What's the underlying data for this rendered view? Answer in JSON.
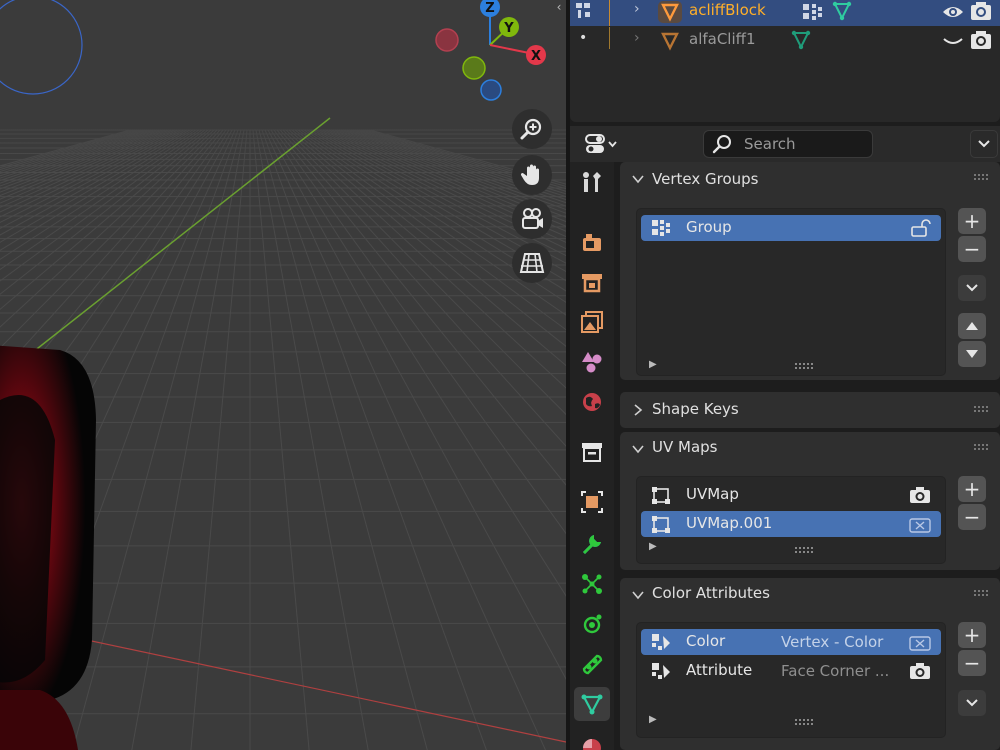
{
  "outliner": {
    "rows": [
      {
        "name": "acliffBlock",
        "selected": true
      },
      {
        "name": "alfaCliff1",
        "selected": false
      }
    ]
  },
  "properties": {
    "search_placeholder": "Search",
    "tabs": [
      "tool-icon",
      "render-icon",
      "output-icon",
      "view-layer-icon",
      "scene-icon",
      "world-icon",
      "collection-icon",
      "object-icon",
      "modifier-icon",
      "particles-icon",
      "physics-icon",
      "constraints-icon",
      "object-data-icon",
      "material-icon"
    ],
    "active_tab": "object-data-icon",
    "panels": {
      "vertex_groups": {
        "title": "Vertex Groups",
        "items": [
          {
            "label": "Group",
            "selected": true,
            "right_icon": "unlock-icon"
          }
        ]
      },
      "shape_keys": {
        "title": "Shape Keys"
      },
      "uv_maps": {
        "title": "UV Maps",
        "items": [
          {
            "label": "UVMap",
            "selected": false,
            "right_icon": "camera-icon"
          },
          {
            "label": "UVMap.001",
            "selected": true,
            "right_icon": "camera-off-icon"
          }
        ]
      },
      "color_attributes": {
        "title": "Color Attributes",
        "items": [
          {
            "label": "Color",
            "sub": "Vertex  -  Color",
            "selected": true,
            "right_icon": "camera-off-icon"
          },
          {
            "label": "Attribute",
            "sub": "Face Corner ...",
            "selected": false,
            "right_icon": "camera-icon"
          }
        ]
      }
    }
  },
  "viewport": {
    "gizmo_axes": [
      "Z",
      "Y",
      "X"
    ],
    "nav_buttons": [
      "zoom-icon",
      "pan-hand-icon",
      "camera-view-icon",
      "grid-ortho-icon"
    ]
  },
  "colors": {
    "accent_selected": "#4772b3",
    "outliner_selected": "#334d80",
    "active_object_text": "#ffaf29",
    "axis_x": "#e3384a",
    "axis_y": "#80b80c",
    "axis_z": "#2c7fde"
  }
}
